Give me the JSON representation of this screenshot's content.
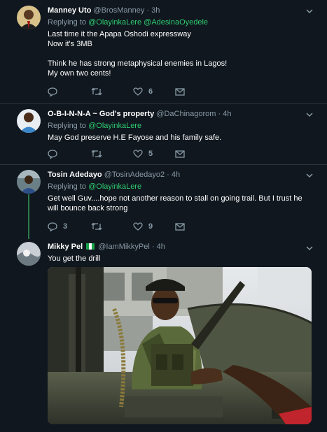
{
  "tweets": [
    {
      "name": "Manney Uto",
      "handle": "@BrosManney",
      "time": "3h",
      "replying_prefix": "Replying to",
      "mentions": [
        "@OlayinkaLere",
        "@AdesinaOyedele"
      ],
      "lines": [
        "Last time it the Apapa Oshodi expressway",
        "Now it's 3MB",
        "",
        "Think he has strong metaphysical enemies in Lagos!",
        "My own two cents!"
      ],
      "reply_count": "",
      "retweet_count": "",
      "like_count": "6"
    },
    {
      "name": "O-B-I-N-N-A ~ God's property",
      "handle": "@DaChinagorom",
      "time": "4h",
      "replying_prefix": "Replying to",
      "mentions": [
        "@OlayinkaLere"
      ],
      "lines": [
        "May God preserve H.E Fayose and his family safe."
      ],
      "reply_count": "",
      "retweet_count": "",
      "like_count": "5"
    },
    {
      "name": "Tosin Adedayo",
      "handle": "@TosinAdedayo2",
      "time": "4h",
      "replying_prefix": "Replying to",
      "mentions": [
        "@OlayinkaLere"
      ],
      "lines": [
        "Get well Guv....hope not another reason to stall on going trail. But I trust he",
        "will bounce back strong"
      ],
      "reply_count": "3",
      "retweet_count": "",
      "like_count": "9"
    },
    {
      "name": "Mikky Pel",
      "handle": "@IamMikkyPel",
      "time": "4h",
      "lines": [
        "You get the drill"
      ]
    }
  ],
  "separator": "·",
  "icons": {
    "caret": "chevron-down-icon",
    "reply": "reply-icon",
    "retweet": "retweet-icon",
    "like": "heart-icon",
    "dm": "envelope-icon",
    "flag": "nigeria-flag-icon"
  },
  "colors": {
    "background": "#10171e",
    "mention": "#2ecc71",
    "muted": "#8899a6",
    "thread_line": "#2b7a4b"
  }
}
